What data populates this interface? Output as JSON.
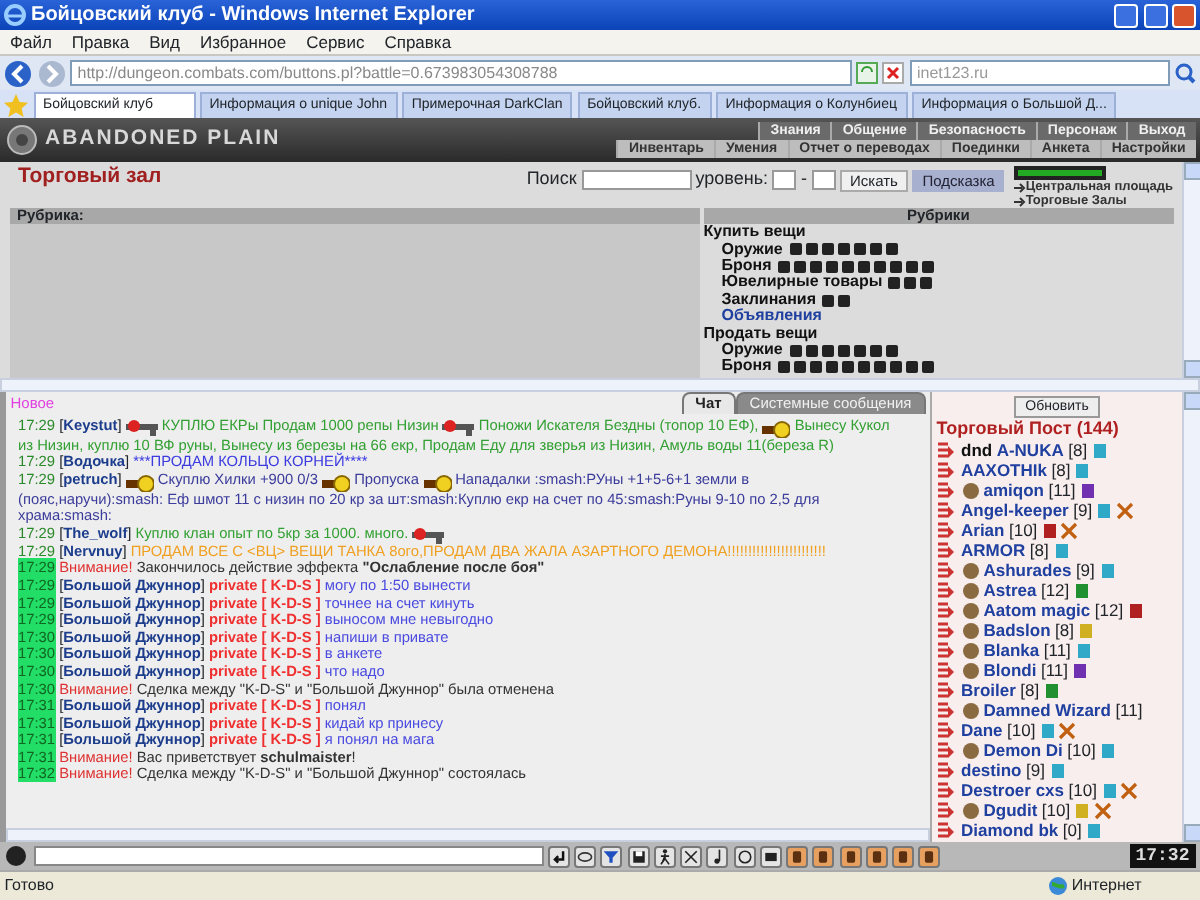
{
  "window": {
    "title": "Бойцовский клуб - Windows Internet Explorer"
  },
  "menu": [
    "Файл",
    "Правка",
    "Вид",
    "Избранное",
    "Сервис",
    "Справка"
  ],
  "address": {
    "url": "http://dungeon.combats.com/buttons.pl?battle=0.673983054308788"
  },
  "web_search": {
    "value": "inet123.ru"
  },
  "tabs": [
    {
      "label": "Бойцовский клуб",
      "selected": true
    },
    {
      "label": "Информация о unique John",
      "selected": false
    },
    {
      "label": "Примерочная DarkClan",
      "selected": false
    },
    {
      "label": "Бойцовский клуб.",
      "selected": false
    },
    {
      "label": "Информация о Колунбиец",
      "selected": false
    },
    {
      "label": "Информация о Большой Д...",
      "selected": false
    }
  ],
  "game": {
    "logo": "ABANDONED PLAIN",
    "nav_top": [
      "Знания",
      "Общение",
      "Безопасность",
      "Персонаж",
      "Выход"
    ],
    "nav_bottom": [
      "Инвентарь",
      "Умения",
      "Отчет о переводах",
      "Поединки",
      "Анкета",
      "Настройки"
    ]
  },
  "trade": {
    "title": "Торговый зал",
    "search_label": "Поиск",
    "level_label": "уровень:",
    "level_dash": "-",
    "search_button": "Искать",
    "hint_button": "Подсказка",
    "links": [
      "Центральная площадь",
      "Торговые Залы"
    ],
    "rubric_header": "Рубрика:",
    "rubrics_header": "Рубрики",
    "rubrics": [
      {
        "label": "Купить вещи",
        "children": [
          {
            "kind": "weapons",
            "label": "Оружие"
          },
          {
            "kind": "armor",
            "label": "Броня"
          },
          {
            "kind": "jewelry",
            "label": "Ювелирные товары"
          },
          {
            "kind": "spells",
            "label": "Заклинания"
          },
          {
            "kind": "link",
            "label": "Объявления"
          }
        ]
      },
      {
        "label": "Продать вещи",
        "children": [
          {
            "kind": "weapons",
            "label": "Оружие"
          },
          {
            "kind": "armor",
            "label": "Броня"
          }
        ]
      }
    ]
  },
  "chat": {
    "new_label": "Новое",
    "tabs": [
      {
        "label": "Чат",
        "selected": true
      },
      {
        "label": "Системные сообщения",
        "selected": false
      }
    ],
    "messages": [
      {
        "kind": "user",
        "time": "17:29",
        "highlight": false,
        "sender": "[**Keystut**]",
        "color": "#33a033",
        "lines": [
          [
            {
              "kind": "gun"
            },
            {
              "kind": "text",
              "text": "КУПЛЮ ЕКРы Продам 1000 репы Низин"
            },
            {
              "kind": "gun"
            },
            {
              "kind": "text",
              "text": "Поножи Искателя Бездны (топор 10 ЕФ),"
            },
            {
              "kind": "smiley"
            },
            {
              "kind": "text",
              "text": "Вынесу Кукол"
            }
          ],
          [
            {
              "kind": "text",
              "text": "из Низин, куплю 10 ВФ руны, Вынесу из березы на 66 екр, Продам Еду для зверья из Низин, Амуль воды 11(береза R)"
            }
          ]
        ]
      },
      {
        "kind": "user",
        "time": "17:29",
        "highlight": false,
        "sender": "[**Водочка**]",
        "color": "#3a3ae0",
        "lines": [
          [
            {
              "kind": "text",
              "text": "***ПРОДАМ КОЛЬЦО КОРНЕЙ****"
            }
          ]
        ]
      },
      {
        "kind": "user",
        "time": "17:29",
        "highlight": false,
        "sender": "[**petruch**]",
        "color": "#3c3c9c",
        "lines": [
          [
            {
              "kind": "smiley"
            },
            {
              "kind": "text",
              "text": "Скуплю Хилки +900 0/3"
            },
            {
              "kind": "smiley"
            },
            {
              "kind": "text",
              "text": "Пропуска"
            },
            {
              "kind": "smiley"
            },
            {
              "kind": "text",
              "text": "Нападалки :smash:РУны +1+5-6+1 земли в"
            }
          ],
          [
            {
              "kind": "text",
              "text": "(пояс,наручи):smash: Еф шмот 11 с низин по 20 кр за шт:smash:Куплю екр на счет по 45:smash:Руны 9-10 по 2,5 для"
            }
          ],
          [
            {
              "kind": "text",
              "text": "храма:smash:"
            }
          ]
        ]
      },
      {
        "kind": "user",
        "time": "17:29",
        "highlight": false,
        "sender": "[**The_wolf**]",
        "color": "#33a033",
        "lines": [
          [
            {
              "kind": "text",
              "text": "Куплю клан опыт по 5кр за 1000. много."
            },
            {
              "kind": "gun"
            }
          ]
        ]
      },
      {
        "kind": "user",
        "time": "17:29",
        "highlight": false,
        "sender": "[**Nervnuy**]",
        "color": "#f0a020",
        "lines": [
          [
            {
              "kind": "text",
              "text": "ПРОДАМ ВСЕ С <ВЦ> ВЕЩИ ТАНКА 8ого,ПРОДАМ ДВА ЖАЛА АЗАРТНОГО ДЕМОНА!!!!!!!!!!!!!!!!!!!!!!!!"
            }
          ]
        ]
      },
      {
        "kind": "system",
        "time": "17:29",
        "highlight": true,
        "alert": "Внимание!",
        "text": "Закончилось действие эффекта **\"Ослабление после боя\"**"
      },
      {
        "kind": "private",
        "time": "17:29",
        "highlight": true,
        "sender": "[**Большой Джуннор**]",
        "tag": "private [ K-D-S ]",
        "text": "могу по 1:50 вынести"
      },
      {
        "kind": "private",
        "time": "17:29",
        "highlight": true,
        "sender": "[**Большой Джуннор**]",
        "tag": "private [ K-D-S ]",
        "text": "точнее на счет кинуть"
      },
      {
        "kind": "private",
        "time": "17:29",
        "highlight": true,
        "sender": "[**Большой Джуннор**]",
        "tag": "private [ K-D-S ]",
        "text": "выносом мне невыгодно"
      },
      {
        "kind": "private",
        "time": "17:30",
        "highlight": true,
        "sender": "[**Большой Джуннор**]",
        "tag": "private [ K-D-S ]",
        "text": "напиши в привате"
      },
      {
        "kind": "private",
        "time": "17:30",
        "highlight": true,
        "sender": "[**Большой Джуннор**]",
        "tag": "private [ K-D-S ]",
        "text": "в анкете"
      },
      {
        "kind": "private",
        "time": "17:30",
        "highlight": true,
        "sender": "[**Большой Джуннор**]",
        "tag": "private [ K-D-S ]",
        "text": "что надо"
      },
      {
        "kind": "system",
        "time": "17:30",
        "highlight": true,
        "alert": "Внимание!",
        "text": "Сделка между \"K-D-S\" и \"Большой Джуннор\" была отменена"
      },
      {
        "kind": "private",
        "time": "17:31",
        "highlight": true,
        "sender": "[**Большой Джуннор**]",
        "tag": "private [ K-D-S ]",
        "text": "понял"
      },
      {
        "kind": "private",
        "time": "17:31",
        "highlight": true,
        "sender": "[**Большой Джуннор**]",
        "tag": "private [ K-D-S ]",
        "text": "кидай кр принесу"
      },
      {
        "kind": "private",
        "time": "17:31",
        "highlight": true,
        "sender": "[**Большой Джуннор**]",
        "tag": "private [ K-D-S ]",
        "text": "я понял на мага"
      },
      {
        "kind": "system",
        "time": "17:31",
        "highlight": true,
        "alert": "Внимание!",
        "text": "Вас приветствует **schulmaister**!"
      },
      {
        "kind": "system",
        "time": "17:32",
        "highlight": true,
        "alert": "Внимание!",
        "text": "Сделка между \"K-D-S\" и \"Большой Джуннор\" состоялась"
      }
    ]
  },
  "players": {
    "refresh_button": "Обновить",
    "title": "Торговый Пост (144)",
    "items": [
      {
        "prefix": "dnd",
        "name": "A-NUKA",
        "level": "[8]",
        "color": "#30a8c8",
        "emblem": false,
        "swords": false
      },
      {
        "name": "AAXOTHIk",
        "level": "[8]",
        "color": "#30a8c8",
        "emblem": false,
        "swords": false
      },
      {
        "name": "amiqon",
        "level": "[11]",
        "color": "#7030b0",
        "emblem": true,
        "swords": false
      },
      {
        "name": "Angel-keeper",
        "level": "[9]",
        "color": "#30a8c8",
        "emblem": false,
        "swords": true
      },
      {
        "name": "Arian",
        "level": "[10]",
        "color": "#b02020",
        "emblem": false,
        "swords": true
      },
      {
        "name": "ARMOR",
        "level": "[8]",
        "color": "#30a8c8",
        "emblem": false,
        "swords": false
      },
      {
        "name": "Ashurades",
        "level": "[9]",
        "color": "#30a8c8",
        "emblem": true,
        "swords": false
      },
      {
        "name": "Astrea",
        "level": "[12]",
        "color": "#209030",
        "emblem": true,
        "swords": false
      },
      {
        "name": "Aatom magic",
        "level": "[12]",
        "color": "#b02020",
        "emblem": true,
        "swords": false
      },
      {
        "name": "Badslon",
        "level": "[8]",
        "color": "#d0b020",
        "emblem": true,
        "swords": false
      },
      {
        "name": "Blanka",
        "level": "[11]",
        "color": "#30a8c8",
        "emblem": true,
        "swords": false
      },
      {
        "name": "Blondi",
        "level": "[11]",
        "color": "#7030b0",
        "emblem": true,
        "swords": false
      },
      {
        "name": "Broiler",
        "level": "[8]",
        "color": "#209030",
        "emblem": false,
        "swords": false
      },
      {
        "name": "Damned Wizard",
        "level": "[11]",
        "emblem": true,
        "swords": false
      },
      {
        "name": "Dane",
        "level": "[10]",
        "color": "#30a8c8",
        "emblem": false,
        "swords": true
      },
      {
        "name": "Demon Di",
        "level": "[10]",
        "color": "#30a8c8",
        "emblem": true,
        "swords": false
      },
      {
        "name": "destino",
        "level": "[9]",
        "color": "#30a8c8",
        "emblem": false,
        "swords": false
      },
      {
        "name": "Destroer cxs",
        "level": "[10]",
        "color": "#30a8c8",
        "emblem": false,
        "swords": true
      },
      {
        "name": "Dgudit",
        "level": "[10]",
        "color": "#d0b020",
        "emblem": true,
        "swords": true
      },
      {
        "name": "Diamond bk",
        "level": "[0]",
        "color": "#30a8c8",
        "emblem": false,
        "swords": false
      }
    ]
  },
  "clock": "17:32",
  "status_bar": {
    "text": "Готово",
    "zone": "Интернет"
  }
}
